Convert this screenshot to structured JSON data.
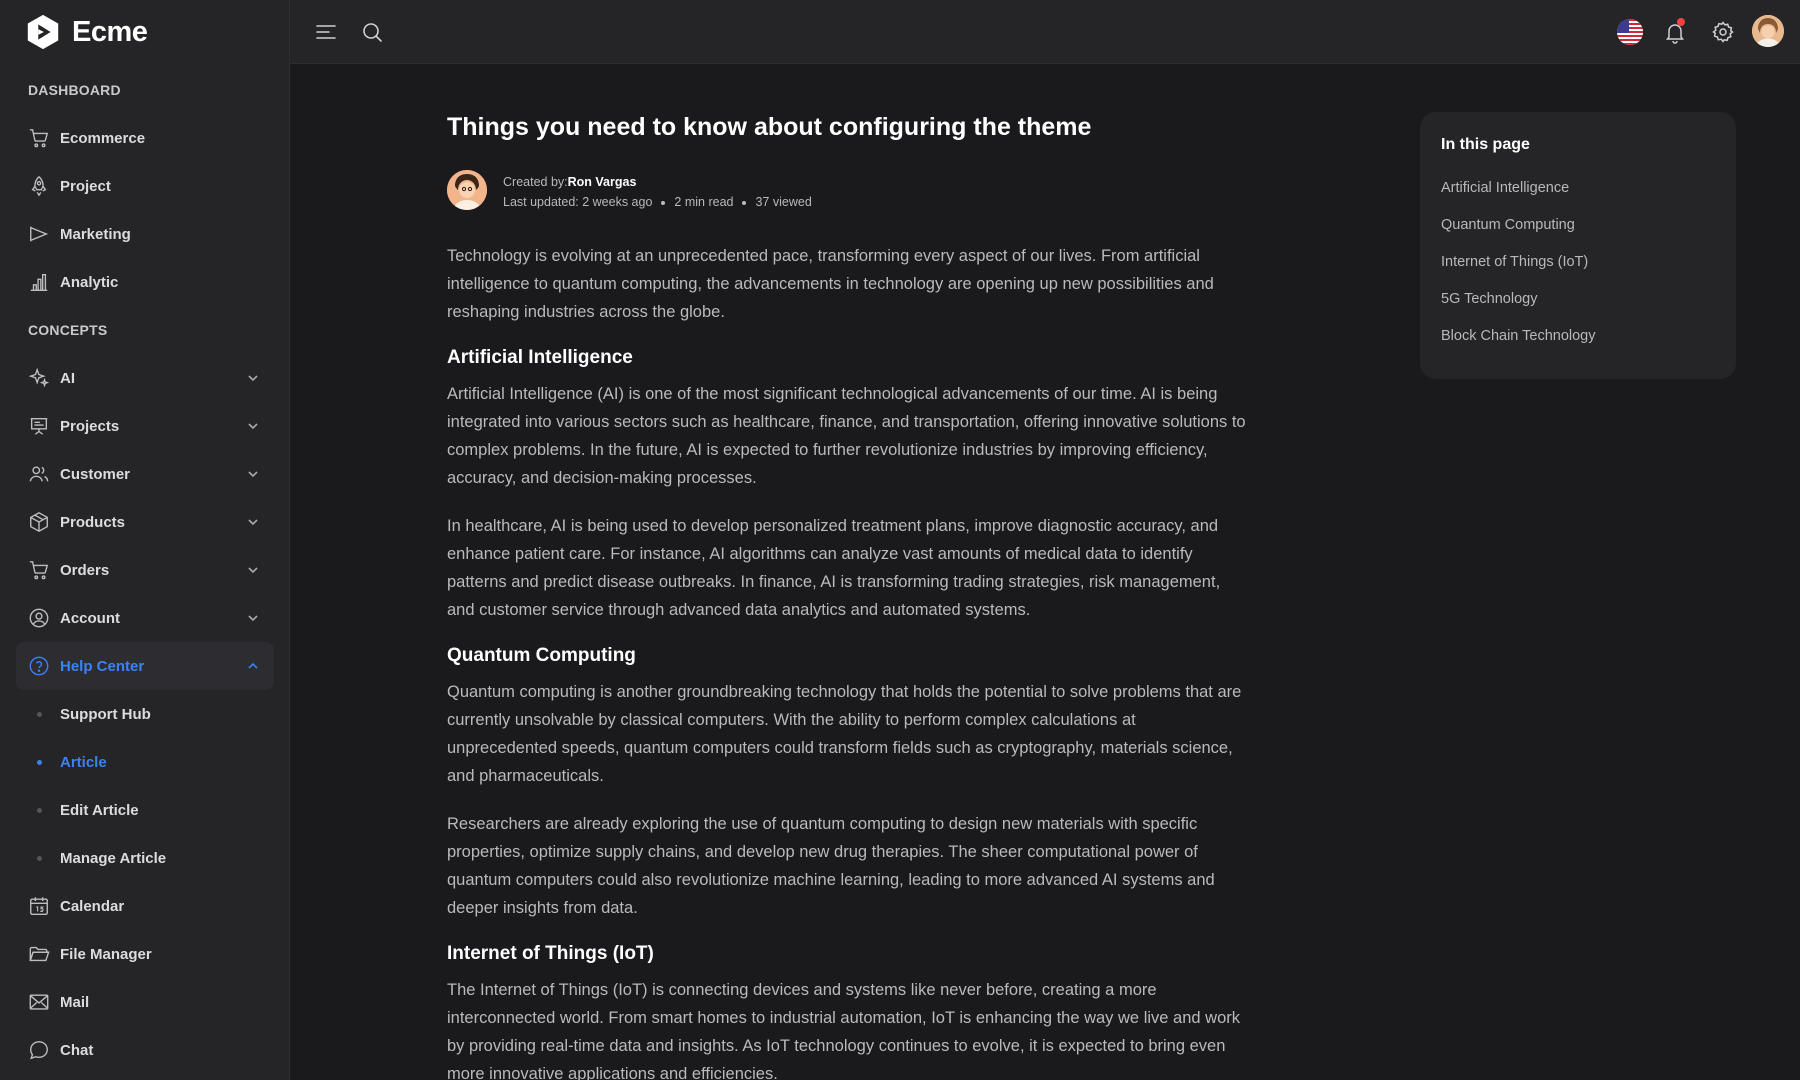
{
  "app": {
    "name": "Ecme"
  },
  "sidebar": {
    "sections": [
      {
        "heading": "DASHBOARD",
        "items": [
          {
            "label": "Ecommerce",
            "icon": "cart-icon"
          },
          {
            "label": "Project",
            "icon": "rocket-icon"
          },
          {
            "label": "Marketing",
            "icon": "megaphone-icon"
          },
          {
            "label": "Analytic",
            "icon": "bar-chart-icon"
          }
        ]
      },
      {
        "heading": "CONCEPTS",
        "items": [
          {
            "label": "AI",
            "icon": "sparkle-icon"
          },
          {
            "label": "Projects",
            "icon": "presentation-icon"
          },
          {
            "label": "Customer",
            "icon": "users-icon"
          },
          {
            "label": "Products",
            "icon": "box-icon"
          },
          {
            "label": "Orders",
            "icon": "cart-icon"
          },
          {
            "label": "Account",
            "icon": "user-circle-icon"
          },
          {
            "label": "Help Center",
            "icon": "help-circle-icon",
            "active": true
          },
          {
            "label": "Support Hub"
          },
          {
            "label": "Article",
            "active": true
          },
          {
            "label": "Edit Article"
          },
          {
            "label": "Manage Article"
          },
          {
            "label": "Calendar",
            "icon": "calendar-icon"
          },
          {
            "label": "File Manager",
            "icon": "folder-icon"
          },
          {
            "label": "Mail",
            "icon": "mail-icon"
          },
          {
            "label": "Chat",
            "icon": "chat-icon"
          }
        ]
      }
    ]
  },
  "topbar": {
    "icons": [
      "menu-icon",
      "search-icon",
      "us-flag-icon",
      "bell-icon",
      "gear-icon",
      "avatar"
    ]
  },
  "article": {
    "title": "Things you need to know about configuring the theme",
    "created_by_label": "Created by:",
    "author": "Ron Vargas",
    "last_updated": "Last updated: 2 weeks ago",
    "read_time": "2 min read",
    "views": "37 viewed",
    "intro": "Technology is evolving at an unprecedented pace, transforming every aspect of our lives. From artificial intelligence to quantum computing, the advancements in technology are opening up new possibilities and reshaping industries across the globe.",
    "sections": [
      {
        "heading": "Artificial Intelligence",
        "paragraphs": [
          "Artificial Intelligence (AI) is one of the most significant technological advancements of our time. AI is being integrated into various sectors such as healthcare, finance, and transportation, offering innovative solutions to complex problems. In the future, AI is expected to further revolutionize industries by improving efficiency, accuracy, and decision-making processes.",
          "In healthcare, AI is being used to develop personalized treatment plans, improve diagnostic accuracy, and enhance patient care. For instance, AI algorithms can analyze vast amounts of medical data to identify patterns and predict disease outbreaks. In finance, AI is transforming trading strategies, risk management, and customer service through advanced data analytics and automated systems."
        ]
      },
      {
        "heading": "Quantum Computing",
        "paragraphs": [
          "Quantum computing is another groundbreaking technology that holds the potential to solve problems that are currently unsolvable by classical computers. With the ability to perform complex calculations at unprecedented speeds, quantum computers could transform fields such as cryptography, materials science, and pharmaceuticals.",
          "Researchers are already exploring the use of quantum computing to design new materials with specific properties, optimize supply chains, and develop new drug therapies. The sheer computational power of quantum computers could also revolutionize machine learning, leading to more advanced AI systems and deeper insights from data."
        ]
      },
      {
        "heading": "Internet of Things (IoT)",
        "paragraphs": [
          "The Internet of Things (IoT) is connecting devices and systems like never before, creating a more interconnected world. From smart homes to industrial automation, IoT is enhancing the way we live and work by providing real-time data and insights. As IoT technology continues to evolve, it is expected to bring even more innovative applications and efficiencies."
        ]
      }
    ]
  },
  "toc": {
    "title": "In this page",
    "links": [
      "Artificial Intelligence",
      "Quantum Computing",
      "Internet of Things (IoT)",
      "5G Technology",
      "Block Chain Technology"
    ]
  },
  "colors": {
    "accent": "#3b82f6",
    "background": "#1a1a1c",
    "panel": "#252527",
    "notification": "#ef4444"
  }
}
